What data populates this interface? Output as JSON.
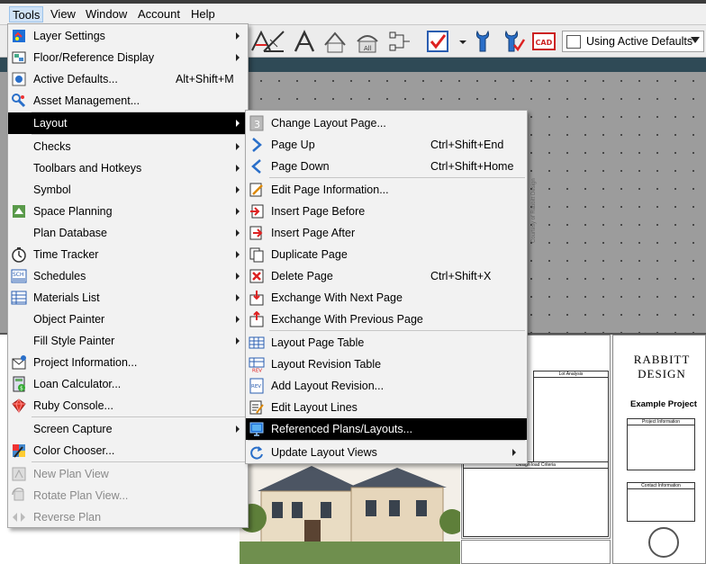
{
  "menubar": {
    "items": [
      {
        "label": "Tools",
        "active": true
      },
      {
        "label": "View"
      },
      {
        "label": "Window"
      },
      {
        "label": "Account"
      },
      {
        "label": "Help"
      }
    ]
  },
  "toolbar": {
    "dropdown_value": "Using Active Defaults",
    "cad_label": "CAD"
  },
  "tools_menu": {
    "items": [
      {
        "label": "Layer Settings",
        "submenu": true,
        "icon": "layer-settings-icon"
      },
      {
        "label": "Floor/Reference Display",
        "submenu": true,
        "icon": "floor-reference-icon"
      },
      {
        "label": "Active Defaults...",
        "shortcut": "Alt+Shift+M",
        "icon": "active-defaults-icon"
      },
      {
        "label": "Asset Management...",
        "icon": "asset-management-icon"
      },
      {
        "label": "Layout",
        "submenu": true,
        "highlighted": true
      },
      {
        "label": "Checks",
        "submenu": true
      },
      {
        "label": "Toolbars and Hotkeys",
        "submenu": true
      },
      {
        "label": "Symbol",
        "submenu": true
      },
      {
        "label": "Space Planning",
        "submenu": true,
        "icon": "space-planning-icon"
      },
      {
        "label": "Plan Database",
        "submenu": true
      },
      {
        "label": "Time Tracker",
        "submenu": true,
        "icon": "time-tracker-icon"
      },
      {
        "label": "Schedules",
        "submenu": true,
        "icon": "schedules-icon"
      },
      {
        "label": "Materials List",
        "submenu": true,
        "icon": "materials-list-icon"
      },
      {
        "label": "Object Painter",
        "submenu": true
      },
      {
        "label": "Fill Style Painter",
        "submenu": true
      },
      {
        "label": "Project Information...",
        "icon": "project-information-icon"
      },
      {
        "label": "Loan Calculator...",
        "icon": "loan-calculator-icon"
      },
      {
        "label": "Ruby Console...",
        "icon": "ruby-console-icon"
      },
      {
        "label": "Screen Capture",
        "submenu": true
      },
      {
        "label": "Color Chooser...",
        "icon": "color-chooser-icon"
      },
      {
        "label": "New Plan View",
        "disabled": true,
        "icon": "new-plan-view-icon"
      },
      {
        "label": "Rotate Plan View...",
        "disabled": true,
        "icon": "rotate-plan-view-icon"
      },
      {
        "label": "Reverse Plan",
        "disabled": true,
        "icon": "reverse-plan-icon"
      }
    ]
  },
  "layout_menu": {
    "items": [
      {
        "label": "Change Layout Page...",
        "icon": "change-layout-page-icon"
      },
      {
        "label": "Page Up",
        "shortcut": "Ctrl+Shift+End",
        "icon": "page-up-icon"
      },
      {
        "label": "Page Down",
        "shortcut": "Ctrl+Shift+Home",
        "icon": "page-down-icon"
      },
      {
        "label": "Edit Page Information...",
        "icon": "edit-page-information-icon"
      },
      {
        "label": "Insert Page Before",
        "icon": "insert-page-before-icon"
      },
      {
        "label": "Insert Page After",
        "icon": "insert-page-after-icon"
      },
      {
        "label": "Duplicate Page",
        "icon": "duplicate-page-icon"
      },
      {
        "label": "Delete Page",
        "shortcut": "Ctrl+Shift+X",
        "icon": "delete-page-icon"
      },
      {
        "label": "Exchange With Next Page",
        "icon": "exchange-next-page-icon"
      },
      {
        "label": "Exchange With Previous Page",
        "icon": "exchange-previous-page-icon"
      },
      {
        "label": "Layout Page Table",
        "icon": "layout-page-table-icon"
      },
      {
        "label": "Layout Revision Table",
        "icon": "layout-revision-table-icon"
      },
      {
        "label": "Add Layout Revision...",
        "icon": "add-layout-revision-icon"
      },
      {
        "label": "Edit Layout Lines",
        "icon": "edit-layout-lines-icon"
      },
      {
        "label": "Referenced Plans/Layouts...",
        "highlighted": true,
        "icon": "referenced-plans-icon"
      },
      {
        "label": "Update Layout Views",
        "submenu": true,
        "icon": "update-layout-views-icon"
      }
    ]
  },
  "sheet": {
    "brand_line1": "RABBITT",
    "brand_line2": "DESIGN",
    "project_title": "Example Project",
    "box1_title": "Project Information",
    "box2_title": "Contact Information",
    "lot_title": "Lot Analysis",
    "design_title": "Design load Criteria"
  }
}
